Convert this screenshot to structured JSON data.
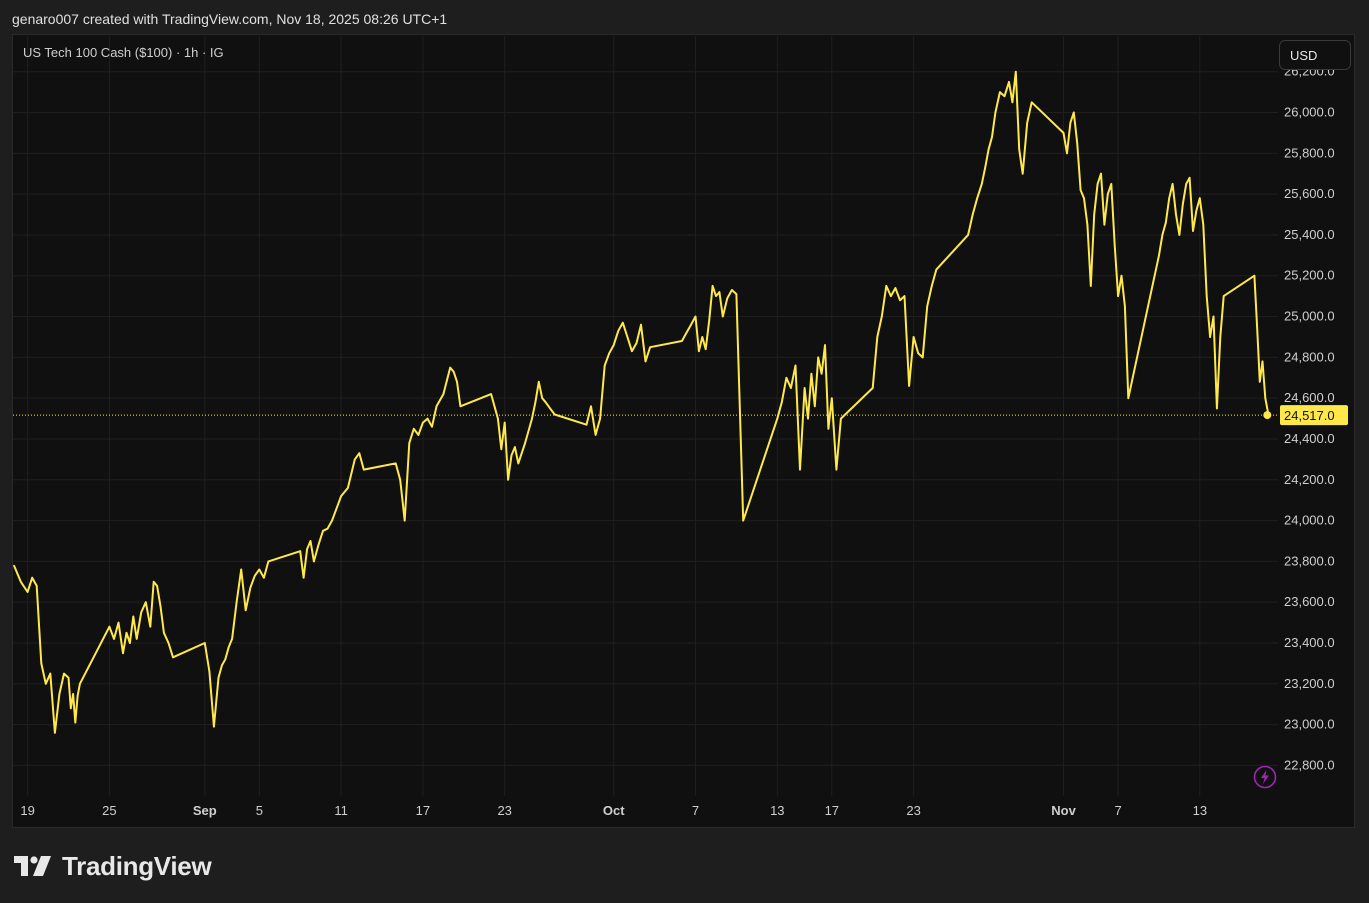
{
  "header": {
    "attribution": "genaro007 created with TradingView.com, Nov 18, 2025 08:26 UTC+1"
  },
  "legend": {
    "symbol_text": "US Tech 100 Cash ($100) · 1h · IG"
  },
  "currency_button": {
    "label": "USD"
  },
  "brand": {
    "name": "TradingView"
  },
  "colors": {
    "line": "#ffe94a",
    "background": "#101010",
    "grid": "#1f1f1f",
    "price_tag": "#ffe94a",
    "bolt": "#9c27b0"
  },
  "icons": {
    "bolt": "lightning-bolt-icon",
    "logo": "tradingview-logo-icon"
  },
  "chart_data": {
    "type": "line",
    "title": "US Tech 100 Cash ($100) · 1h · IG",
    "currency": "USD",
    "ylim": [
      22650,
      26380
    ],
    "y_ticks": [
      22800,
      23000,
      23200,
      23400,
      23600,
      23800,
      24000,
      24200,
      24400,
      24600,
      24800,
      25000,
      25200,
      25400,
      25600,
      25800,
      26000,
      26200
    ],
    "y_tick_labels": [
      "22,800.0",
      "23,000.0",
      "23,200.0",
      "23,400.0",
      "23,600.0",
      "23,800.0",
      "24,000.0",
      "24,200.0",
      "24,400.0",
      "24,600.0",
      "24,800.0",
      "25,000.0",
      "25,200.0",
      "25,400.0",
      "25,600.0",
      "25,800.0",
      "26,000.0",
      "26,200.0"
    ],
    "x_ticks": [
      {
        "date": "2025-08-19",
        "label": "19",
        "bold": false
      },
      {
        "date": "2025-08-25",
        "label": "25",
        "bold": false
      },
      {
        "date": "2025-09-01",
        "label": "Sep",
        "bold": true
      },
      {
        "date": "2025-09-05",
        "label": "5",
        "bold": false
      },
      {
        "date": "2025-09-11",
        "label": "11",
        "bold": false
      },
      {
        "date": "2025-09-17",
        "label": "17",
        "bold": false
      },
      {
        "date": "2025-09-23",
        "label": "23",
        "bold": false
      },
      {
        "date": "2025-10-01",
        "label": "Oct",
        "bold": true
      },
      {
        "date": "2025-10-07",
        "label": "7",
        "bold": false
      },
      {
        "date": "2025-10-13",
        "label": "13",
        "bold": false
      },
      {
        "date": "2025-10-17",
        "label": "17",
        "bold": false
      },
      {
        "date": "2025-10-23",
        "label": "23",
        "bold": false
      },
      {
        "date": "2025-11-03",
        "label": "Nov",
        "bold": true
      },
      {
        "date": "2025-11-07",
        "label": "7",
        "bold": false
      },
      {
        "date": "2025-11-13",
        "label": "13",
        "bold": false
      }
    ],
    "last_price": 24517.0,
    "last_price_label": "24,517.0",
    "series": [
      {
        "values": [
          [
            "2025-08-18",
            23780
          ],
          [
            "2025-08-18",
            23700
          ],
          [
            "2025-08-19",
            23650
          ],
          [
            "2025-08-19",
            23720
          ],
          [
            "2025-08-19",
            23680
          ],
          [
            "2025-08-20",
            23300
          ],
          [
            "2025-08-20",
            23200
          ],
          [
            "2025-08-20",
            23250
          ],
          [
            "2025-08-21",
            22960
          ],
          [
            "2025-08-21",
            23150
          ],
          [
            "2025-08-21",
            23250
          ],
          [
            "2025-08-22",
            23230
          ],
          [
            "2025-08-22",
            23080
          ],
          [
            "2025-08-22",
            23150
          ],
          [
            "2025-08-22",
            23010
          ],
          [
            "2025-08-22",
            23140
          ],
          [
            "2025-08-22",
            23200
          ],
          [
            "2025-08-25",
            23480
          ],
          [
            "2025-08-25",
            23420
          ],
          [
            "2025-08-25",
            23500
          ],
          [
            "2025-08-26",
            23350
          ],
          [
            "2025-08-26",
            23450
          ],
          [
            "2025-08-26",
            23400
          ],
          [
            "2025-08-26",
            23530
          ],
          [
            "2025-08-27",
            23420
          ],
          [
            "2025-08-27",
            23550
          ],
          [
            "2025-08-27",
            23600
          ],
          [
            "2025-08-28",
            23480
          ],
          [
            "2025-08-28",
            23700
          ],
          [
            "2025-08-28",
            23680
          ],
          [
            "2025-08-28",
            23580
          ],
          [
            "2025-08-29",
            23450
          ],
          [
            "2025-08-29",
            23400
          ],
          [
            "2025-08-29",
            23330
          ],
          [
            "2025-09-01",
            23400
          ],
          [
            "2025-09-01",
            23260
          ],
          [
            "2025-09-01",
            22990
          ],
          [
            "2025-09-02",
            23230
          ],
          [
            "2025-09-02",
            23290
          ],
          [
            "2025-09-02",
            23320
          ],
          [
            "2025-09-02",
            23380
          ],
          [
            "2025-09-03",
            23420
          ],
          [
            "2025-09-03",
            23600
          ],
          [
            "2025-09-03",
            23760
          ],
          [
            "2025-09-04",
            23560
          ],
          [
            "2025-09-04",
            23670
          ],
          [
            "2025-09-04",
            23730
          ],
          [
            "2025-09-05",
            23760
          ],
          [
            "2025-09-05",
            23720
          ],
          [
            "2025-09-05",
            23800
          ],
          [
            "2025-09-08",
            23850
          ],
          [
            "2025-09-08",
            23720
          ],
          [
            "2025-09-08",
            23860
          ],
          [
            "2025-09-08",
            23900
          ],
          [
            "2025-09-09",
            23800
          ],
          [
            "2025-09-09",
            23880
          ],
          [
            "2025-09-09",
            23950
          ],
          [
            "2025-09-10",
            23960
          ],
          [
            "2025-09-10",
            24000
          ],
          [
            "2025-09-10",
            24060
          ],
          [
            "2025-09-11",
            24120
          ],
          [
            "2025-09-11",
            24160
          ],
          [
            "2025-09-12",
            24300
          ],
          [
            "2025-09-12",
            24330
          ],
          [
            "2025-09-12",
            24250
          ],
          [
            "2025-09-15",
            24280
          ],
          [
            "2025-09-15",
            24200
          ],
          [
            "2025-09-15",
            24000
          ],
          [
            "2025-09-16",
            24380
          ],
          [
            "2025-09-16",
            24450
          ],
          [
            "2025-09-16",
            24420
          ],
          [
            "2025-09-17",
            24480
          ],
          [
            "2025-09-17",
            24500
          ],
          [
            "2025-09-17",
            24460
          ],
          [
            "2025-09-18",
            24560
          ],
          [
            "2025-09-18",
            24620
          ],
          [
            "2025-09-19",
            24750
          ],
          [
            "2025-09-19",
            24730
          ],
          [
            "2025-09-19",
            24680
          ],
          [
            "2025-09-19",
            24560
          ],
          [
            "2025-09-22",
            24620
          ],
          [
            "2025-09-22",
            24560
          ],
          [
            "2025-09-22",
            24500
          ],
          [
            "2025-09-22",
            24350
          ],
          [
            "2025-09-23",
            24480
          ],
          [
            "2025-09-23",
            24200
          ],
          [
            "2025-09-23",
            24320
          ],
          [
            "2025-09-23",
            24360
          ],
          [
            "2025-09-24",
            24280
          ],
          [
            "2025-09-24",
            24380
          ],
          [
            "2025-09-25",
            24500
          ],
          [
            "2025-09-25",
            24580
          ],
          [
            "2025-09-25",
            24680
          ],
          [
            "2025-09-25",
            24600
          ],
          [
            "2025-09-26",
            24580
          ],
          [
            "2025-09-26",
            24550
          ],
          [
            "2025-09-26",
            24520
          ],
          [
            "2025-09-29",
            24470
          ],
          [
            "2025-09-29",
            24560
          ],
          [
            "2025-09-29",
            24420
          ],
          [
            "2025-09-30",
            24500
          ],
          [
            "2025-09-30",
            24760
          ],
          [
            "2025-09-30",
            24820
          ],
          [
            "2025-10-01",
            24860
          ],
          [
            "2025-10-01",
            24930
          ],
          [
            "2025-10-01",
            24970
          ],
          [
            "2025-10-02",
            24900
          ],
          [
            "2025-10-02",
            24830
          ],
          [
            "2025-10-02",
            24870
          ],
          [
            "2025-10-03",
            24960
          ],
          [
            "2025-10-03",
            24780
          ],
          [
            "2025-10-03",
            24850
          ],
          [
            "2025-10-06",
            24880
          ],
          [
            "2025-10-06",
            24920
          ],
          [
            "2025-10-06",
            24960
          ],
          [
            "2025-10-07",
            25000
          ],
          [
            "2025-10-07",
            24830
          ],
          [
            "2025-10-07",
            24900
          ],
          [
            "2025-10-07",
            24840
          ],
          [
            "2025-10-08",
            24980
          ],
          [
            "2025-10-08",
            25150
          ],
          [
            "2025-10-08",
            25100
          ],
          [
            "2025-10-08",
            25120
          ],
          [
            "2025-10-09",
            25000
          ],
          [
            "2025-10-09",
            25090
          ],
          [
            "2025-10-09",
            25130
          ],
          [
            "2025-10-10",
            25110
          ],
          [
            "2025-10-10",
            24000
          ],
          [
            "2025-10-13",
            24500
          ],
          [
            "2025-10-13",
            24580
          ],
          [
            "2025-10-13",
            24700
          ],
          [
            "2025-10-14",
            24650
          ],
          [
            "2025-10-14",
            24760
          ],
          [
            "2025-10-14",
            24250
          ],
          [
            "2025-10-15",
            24650
          ],
          [
            "2025-10-15",
            24500
          ],
          [
            "2025-10-15",
            24720
          ],
          [
            "2025-10-15",
            24560
          ],
          [
            "2025-10-16",
            24800
          ],
          [
            "2025-10-16",
            24720
          ],
          [
            "2025-10-16",
            24860
          ],
          [
            "2025-10-16",
            24450
          ],
          [
            "2025-10-17",
            24600
          ],
          [
            "2025-10-17",
            24250
          ],
          [
            "2025-10-17",
            24500
          ],
          [
            "2025-10-20",
            24650
          ],
          [
            "2025-10-20",
            24900
          ],
          [
            "2025-10-20",
            25000
          ],
          [
            "2025-10-21",
            25150
          ],
          [
            "2025-10-21",
            25100
          ],
          [
            "2025-10-21",
            25140
          ],
          [
            "2025-10-22",
            25080
          ],
          [
            "2025-10-22",
            25100
          ],
          [
            "2025-10-22",
            24660
          ],
          [
            "2025-10-23",
            24900
          ],
          [
            "2025-10-23",
            24820
          ],
          [
            "2025-10-23",
            24800
          ],
          [
            "2025-10-24",
            25050
          ],
          [
            "2025-10-24",
            25150
          ],
          [
            "2025-10-24",
            25230
          ],
          [
            "2025-10-27",
            25400
          ],
          [
            "2025-10-27",
            25500
          ],
          [
            "2025-10-27",
            25580
          ],
          [
            "2025-10-28",
            25650
          ],
          [
            "2025-10-28",
            25730
          ],
          [
            "2025-10-28",
            25820
          ],
          [
            "2025-10-28",
            25880
          ],
          [
            "2025-10-29",
            26000
          ],
          [
            "2025-10-29",
            26100
          ],
          [
            "2025-10-29",
            26080
          ],
          [
            "2025-10-30",
            26150
          ],
          [
            "2025-10-30",
            26050
          ],
          [
            "2025-10-30",
            26200
          ],
          [
            "2025-10-30",
            25820
          ],
          [
            "2025-10-31",
            25700
          ],
          [
            "2025-10-31",
            25950
          ],
          [
            "2025-10-31",
            26050
          ],
          [
            "2025-11-03",
            25900
          ],
          [
            "2025-11-03",
            25800
          ],
          [
            "2025-11-03",
            25950
          ],
          [
            "2025-11-03",
            26000
          ],
          [
            "2025-11-04",
            25850
          ],
          [
            "2025-11-04",
            25620
          ],
          [
            "2025-11-04",
            25580
          ],
          [
            "2025-11-04",
            25450
          ],
          [
            "2025-11-05",
            25150
          ],
          [
            "2025-11-05",
            25500
          ],
          [
            "2025-11-05",
            25650
          ],
          [
            "2025-11-05",
            25700
          ],
          [
            "2025-11-06",
            25450
          ],
          [
            "2025-11-06",
            25600
          ],
          [
            "2025-11-06",
            25650
          ],
          [
            "2025-11-06",
            25350
          ],
          [
            "2025-11-07",
            25100
          ],
          [
            "2025-11-07",
            25200
          ],
          [
            "2025-11-07",
            25050
          ],
          [
            "2025-11-07",
            24600
          ],
          [
            "2025-11-10",
            25300
          ],
          [
            "2025-11-10",
            25400
          ],
          [
            "2025-11-10",
            25460
          ],
          [
            "2025-11-10",
            25580
          ],
          [
            "2025-11-11",
            25650
          ],
          [
            "2025-11-11",
            25500
          ],
          [
            "2025-11-11",
            25400
          ],
          [
            "2025-11-11",
            25550
          ],
          [
            "2025-11-12",
            25650
          ],
          [
            "2025-11-12",
            25680
          ],
          [
            "2025-11-12",
            25420
          ],
          [
            "2025-11-12",
            25520
          ],
          [
            "2025-11-13",
            25580
          ],
          [
            "2025-11-13",
            25450
          ],
          [
            "2025-11-13",
            25100
          ],
          [
            "2025-11-13",
            24900
          ],
          [
            "2025-11-14",
            25000
          ],
          [
            "2025-11-14",
            24550
          ],
          [
            "2025-11-14",
            24900
          ],
          [
            "2025-11-14",
            25100
          ],
          [
            "2025-11-17",
            25200
          ],
          [
            "2025-11-17",
            24950
          ],
          [
            "2025-11-17",
            24680
          ],
          [
            "2025-11-17",
            24780
          ],
          [
            "2025-11-17",
            24600
          ],
          [
            "2025-11-18",
            24530
          ],
          [
            "2025-11-18",
            24517
          ]
        ]
      }
    ]
  }
}
